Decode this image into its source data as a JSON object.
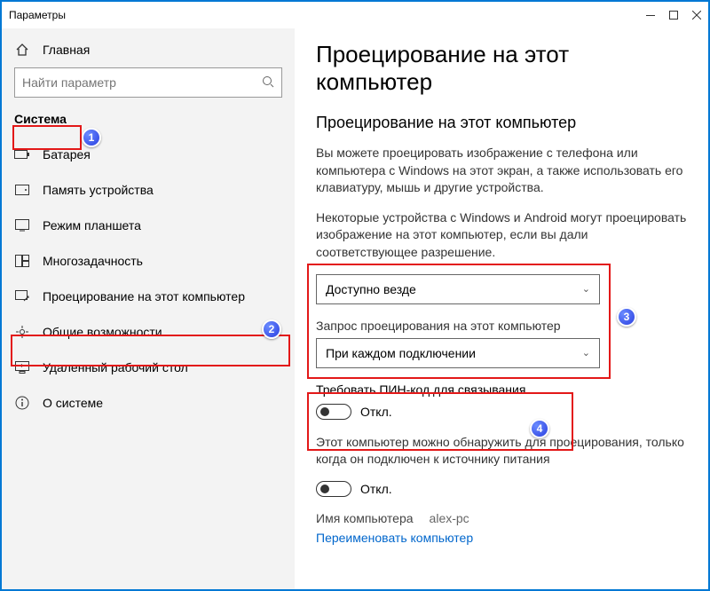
{
  "titlebar": {
    "title": "Параметры"
  },
  "sidebar": {
    "home_label": "Главная",
    "search_placeholder": "Найти параметр",
    "section_label": "Система",
    "items": [
      {
        "label": "Батарея"
      },
      {
        "label": "Память устройства"
      },
      {
        "label": "Режим планшета"
      },
      {
        "label": "Многозадачность"
      },
      {
        "label": "Проецирование на этот компьютер"
      },
      {
        "label": "Общие возможности"
      },
      {
        "label": "Удаленный рабочий стол"
      },
      {
        "label": "О системе"
      }
    ]
  },
  "main": {
    "title": "Проецирование на этот компьютер",
    "subtitle": "Проецирование на этот компьютер",
    "para1": "Вы можете проецировать изображение с телефона или компьютера с Windows на этот экран, а также использовать его клавиатуру, мышь и другие устройства.",
    "para2": "Некоторые устройства с Windows и Android могут проецировать изображение на этот компьютер, если вы дали соответствующее разрешение.",
    "select1_value": "Доступно везде",
    "select2_label": "Запрос проецирования на этот компьютер",
    "select2_value": "При каждом подключении",
    "pin_label": "Требовать ПИН-код для связывания",
    "off_text": "Откл.",
    "power_label": "Этот компьютер можно обнаружить для проецирования, только когда он подключен к источнику питания",
    "pcname_label": "Имя компьютера",
    "pcname_value": "alex-pc",
    "rename_link": "Переименовать компьютер"
  },
  "annotations": {
    "b1": "1",
    "b2": "2",
    "b3": "3",
    "b4": "4"
  }
}
